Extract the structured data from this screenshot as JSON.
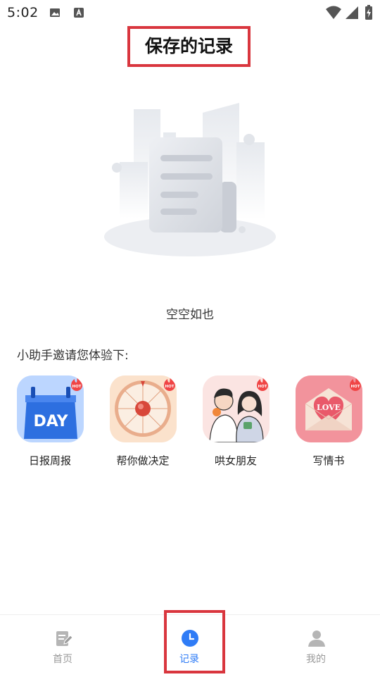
{
  "status_bar": {
    "time": "5:02"
  },
  "header": {
    "title": "保存的记录"
  },
  "empty_state": {
    "message": "空空如也"
  },
  "recommend": {
    "intro": "小助手邀请您体验下:",
    "apps": [
      {
        "label": "日报周报",
        "icon": "day-calendar-icon",
        "icon_text": "DAY",
        "badge": "HOT"
      },
      {
        "label": "帮你做决定",
        "icon": "decision-wheel-icon",
        "badge": "HOT"
      },
      {
        "label": "哄女朋友",
        "icon": "couple-icon",
        "badge": "HOT"
      },
      {
        "label": "写情书",
        "icon": "love-letter-icon",
        "icon_text": "LOVE",
        "badge": "HOT"
      }
    ]
  },
  "bottom_nav": {
    "items": [
      {
        "label": "首页",
        "icon": "edit-note-icon",
        "active": false
      },
      {
        "label": "记录",
        "icon": "clock-icon",
        "active": true
      },
      {
        "label": "我的",
        "icon": "user-icon",
        "active": false
      }
    ]
  },
  "colors": {
    "accent": "#2f7cf6",
    "highlight": "#d9363e",
    "inactive": "#9a9a9a"
  }
}
